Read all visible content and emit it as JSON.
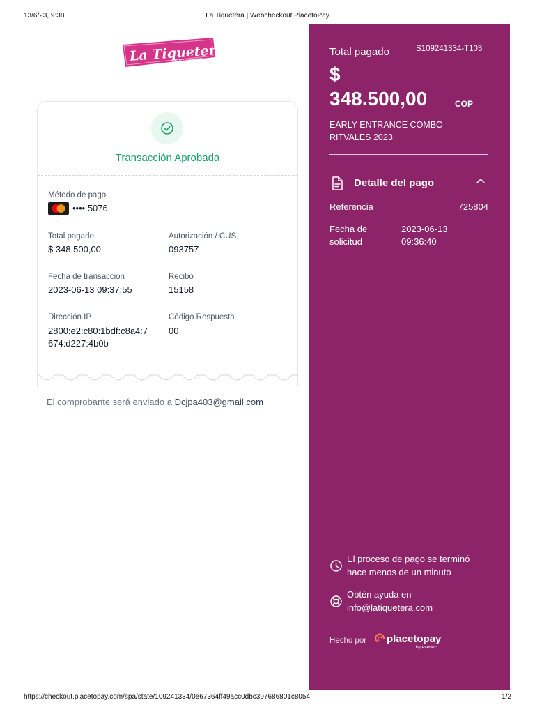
{
  "print_header": {
    "datetime": "13/6/23, 9:38",
    "title": "La Tiquetera | Webcheckout PlacetoPay"
  },
  "print_footer": {
    "url": "https://checkout.placetopay.com/spa/state/109241334/0e67364ff49acc0dbc397686801c8054",
    "page": "1/2"
  },
  "brand": {
    "name": "La Tiquetera",
    "tagline": "ENTRETENIMIENTO",
    "color": "#d6338a"
  },
  "receipt": {
    "status": "Transacción Aprobada",
    "payment_method_label": "Método de pago",
    "card_masked": "•••• 5076",
    "total_label": "Total pagado",
    "total_value": "$ 348.500,00",
    "auth_label": "Autorización / CUS",
    "auth_value": "093757",
    "date_label": "Fecha de transacción",
    "date_value": "2023-06-13 09:37:55",
    "receipt_label": "Recibo",
    "receipt_value": "15158",
    "ip_label": "Dirección IP",
    "ip_line1": "2800:e2:c80:1bdf:c8a4:7",
    "ip_line2": "674:d227:4b0b",
    "code_label": "Código Respuesta",
    "code_value": "00",
    "status_color": "#1aa36a"
  },
  "email_notice": {
    "text": "El comprobante será enviado a ",
    "email": "Dcjpa403@gmail.com"
  },
  "summary": {
    "total_label": "Total pagado",
    "reference_code": "S109241334-T103",
    "currency_symbol": "$",
    "amount": "348.500,00",
    "currency": "COP",
    "description_line1": "EARLY ENTRANCE COMBO",
    "description_line2": "RITVALES 2023",
    "panel_color": "#8d2469"
  },
  "detail": {
    "title": "Detalle del pago",
    "reference_label": "Referencia",
    "reference_value": "725804",
    "request_date_label_line1": "Fecha de",
    "request_date_label_line2": "solicitud",
    "request_date_line1": "2023-06-13",
    "request_date_line2": "09:36:40"
  },
  "footer_info": {
    "process_line1": "El proceso de pago se terminó",
    "process_line2": "hace menos de un minuto",
    "help_line1": "Obtén ayuda en",
    "help_line2": "info@latiquetera.com",
    "made_by": "Hecho por",
    "provider_name": "placetopay",
    "provider_sub": "by evertec"
  }
}
